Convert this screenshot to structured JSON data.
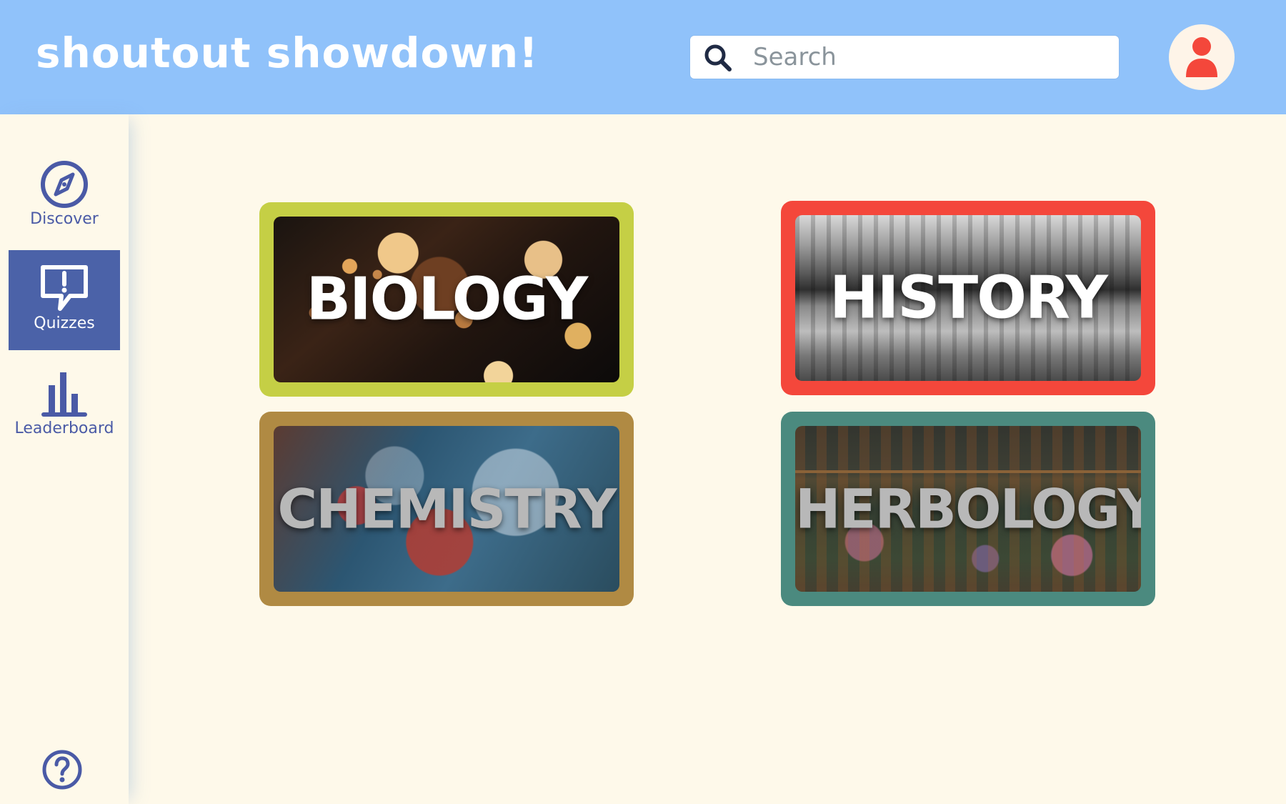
{
  "header": {
    "app_title": "shoutout showdown!",
    "search_placeholder": "Search",
    "avatar_icon": "user-icon"
  },
  "sidebar": {
    "items": [
      {
        "label": "Discover",
        "icon": "compass-icon",
        "active": false
      },
      {
        "label": "Quizzes",
        "icon": "speech-bubble-exclamation-icon",
        "active": true
      },
      {
        "label": "Leaderboard",
        "icon": "bar-chart-icon",
        "active": false
      }
    ],
    "help_icon": "help-icon"
  },
  "quizzes": {
    "cards": [
      {
        "title": "BIOLOGY",
        "border_color": "#c5cf45"
      },
      {
        "title": "HISTORY",
        "border_color": "#f4473b"
      },
      {
        "title": "CHEMISTRY",
        "border_color": "#b08a43"
      },
      {
        "title": "HERBOLOGY",
        "border_color": "#4b8a7f"
      }
    ]
  },
  "colors": {
    "header_bg": "#90c2fa",
    "page_bg": "#fef9ea",
    "accent": "#4b62a8",
    "avatar_red": "#f4473b"
  }
}
